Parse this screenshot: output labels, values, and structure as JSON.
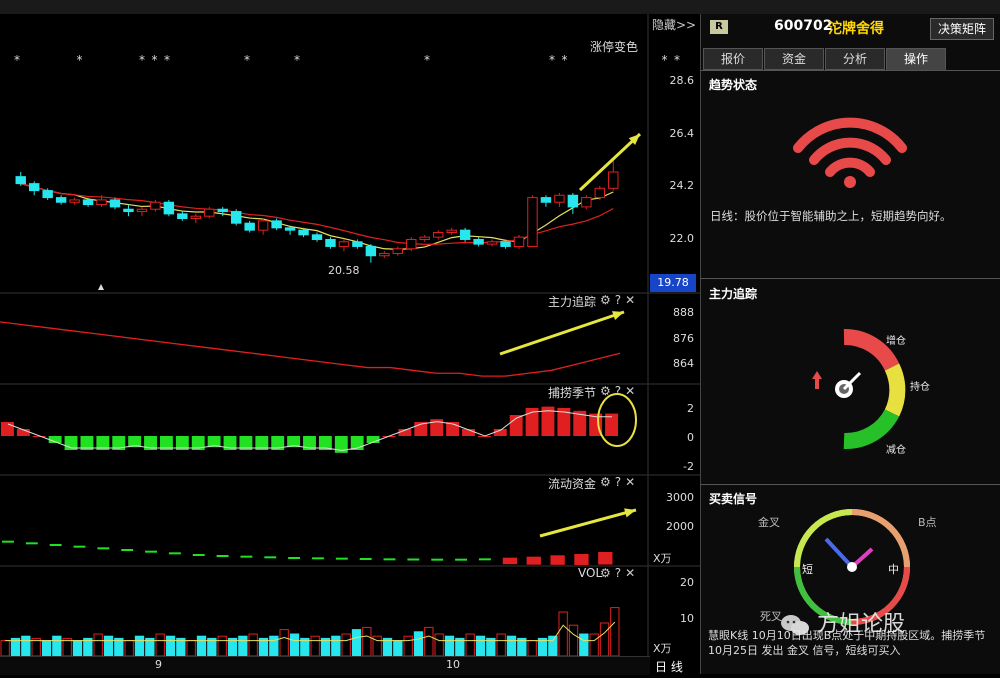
{
  "toolbar": {
    "hide_label": "隐藏>>"
  },
  "main_chart": {
    "title": "涨停变色",
    "price_ticks": [
      "28.6",
      "26.4",
      "24.2",
      "22.0"
    ],
    "current_price": "19.78",
    "low_annotation": "20.58",
    "marker_char": "*"
  },
  "indicators": {
    "main_tracking": {
      "title": "主力追踪",
      "ticks": [
        "888",
        "876",
        "864"
      ]
    },
    "season": {
      "title": "捕捞季节",
      "ticks": [
        "2",
        "0",
        "-2"
      ]
    },
    "flow": {
      "title": "流动资金",
      "ticks": [
        "3000",
        "2000"
      ],
      "unit": "X万"
    },
    "vol": {
      "title": "VOL",
      "ticks": [
        "20",
        "10"
      ],
      "unit": "X万"
    },
    "icons": {
      "settings": "gear-icon",
      "help_label": "?",
      "close_label": "✕"
    }
  },
  "x_axis": {
    "labels": [
      "9",
      "10"
    ],
    "period": "日 线"
  },
  "right_panel": {
    "badge": "R",
    "stock_code": "600702",
    "stock_name": "沱牌舍得",
    "decision_button": "决策矩阵",
    "tabs": [
      "报价",
      "资金",
      "分析",
      "操作"
    ],
    "active_tab": "操作",
    "trend": {
      "title": "趋势状态",
      "description": "日线：股价位于智能辅助之上，短期趋势向好。"
    },
    "tracking": {
      "title": "主力追踪",
      "labels": [
        "增仓",
        "持仓",
        "减仓"
      ]
    },
    "signals": {
      "title": "买卖信号",
      "labels": [
        "金叉",
        "B点",
        "短",
        "中",
        "死叉"
      ]
    },
    "bottom_text": "慧眼K线  10月10日出现B点处于中期持股区域。捕捞季节  10月25日 发出 金叉 信号，短线可买入"
  },
  "watermark": "方姐论股",
  "colors": {
    "up": "#e02020",
    "down": "#28e6ee",
    "green": "#22e022",
    "arrow": "#e6e640",
    "price_box": "#1645c8"
  },
  "chart_data": {
    "type": "candlestick",
    "x_labels": [
      "9",
      "10"
    ],
    "price_axis": {
      "ticks": [
        28.6,
        26.4,
        24.2,
        22.0
      ],
      "ylim": [
        19.6,
        29.4
      ]
    },
    "candles": [
      [
        24.3,
        24.0,
        24.5,
        23.9
      ],
      [
        24.0,
        23.7,
        24.1,
        23.5
      ],
      [
        23.7,
        23.4,
        23.8,
        23.3
      ],
      [
        23.4,
        23.2,
        23.5,
        23.1
      ],
      [
        23.2,
        23.3,
        23.4,
        23.1
      ],
      [
        23.3,
        23.1,
        23.4,
        23.0
      ],
      [
        23.1,
        23.3,
        23.5,
        23.0
      ],
      [
        23.3,
        23.0,
        23.4,
        22.9
      ],
      [
        22.9,
        22.8,
        23.1,
        22.6
      ],
      [
        22.8,
        22.9,
        23.0,
        22.6
      ],
      [
        22.9,
        23.2,
        23.3,
        22.8
      ],
      [
        23.2,
        22.7,
        23.3,
        22.6
      ],
      [
        22.7,
        22.5,
        22.8,
        22.4
      ],
      [
        22.5,
        22.6,
        22.7,
        22.3
      ],
      [
        22.6,
        22.9,
        23.0,
        22.5
      ],
      [
        22.9,
        22.8,
        23.0,
        22.6
      ],
      [
        22.8,
        22.3,
        22.9,
        22.2
      ],
      [
        22.3,
        22.0,
        22.4,
        21.9
      ],
      [
        22.0,
        22.4,
        22.5,
        21.8
      ],
      [
        22.4,
        22.1,
        22.5,
        22.0
      ],
      [
        22.1,
        22.0,
        22.2,
        21.8
      ],
      [
        22.0,
        21.8,
        22.1,
        21.7
      ],
      [
        21.8,
        21.6,
        21.9,
        21.5
      ],
      [
        21.6,
        21.3,
        21.7,
        21.2
      ],
      [
        21.3,
        21.5,
        21.6,
        21.1
      ],
      [
        21.5,
        21.3,
        21.6,
        21.2
      ],
      [
        21.3,
        20.9,
        21.4,
        20.6
      ],
      [
        20.9,
        21.0,
        21.1,
        20.8
      ],
      [
        21.0,
        21.2,
        21.3,
        20.9
      ],
      [
        21.2,
        21.6,
        21.7,
        21.1
      ],
      [
        21.6,
        21.7,
        21.8,
        21.5
      ],
      [
        21.7,
        21.9,
        22.0,
        21.6
      ],
      [
        21.9,
        22.0,
        22.1,
        21.8
      ],
      [
        22.0,
        21.6,
        22.1,
        21.5
      ],
      [
        21.6,
        21.4,
        21.7,
        21.3
      ],
      [
        21.4,
        21.5,
        21.6,
        21.3
      ],
      [
        21.5,
        21.3,
        21.6,
        21.2
      ],
      [
        21.3,
        21.7,
        21.8,
        21.2
      ],
      [
        21.3,
        23.4,
        23.5,
        21.3
      ],
      [
        23.4,
        23.2,
        23.5,
        23.0
      ],
      [
        23.2,
        23.5,
        23.6,
        23.0
      ],
      [
        23.5,
        23.0,
        23.6,
        22.7
      ],
      [
        23.0,
        23.4,
        23.5,
        22.9
      ],
      [
        23.4,
        23.8,
        23.9,
        23.3
      ],
      [
        23.8,
        24.5,
        25.0,
        23.7
      ]
    ],
    "main_tracking": [
      882,
      881,
      880,
      879,
      878,
      877,
      876,
      875,
      874,
      873,
      872,
      871,
      870,
      869,
      868,
      867,
      866,
      866,
      865,
      864,
      864,
      863,
      863,
      864,
      865,
      867,
      869,
      871
    ],
    "season": [
      1,
      0.5,
      0,
      -0.5,
      -1,
      -1,
      -1,
      -1,
      -0.8,
      -1,
      -1,
      -1,
      -1,
      -0.8,
      -1,
      -1,
      -1,
      -1,
      -0.8,
      -1,
      -1,
      -1.2,
      -1,
      -0.5,
      0,
      0.5,
      1,
      1.2,
      1,
      0.5,
      0,
      0.5,
      1.5,
      2,
      2.1,
      2,
      1.8,
      1.6,
      1.6
    ],
    "flow": [
      1600,
      1550,
      1500,
      1450,
      1400,
      1350,
      1300,
      1250,
      1200,
      1170,
      1150,
      1130,
      1110,
      1100,
      1090,
      1080,
      1070,
      1065,
      1060,
      1060,
      1070,
      1090,
      1120,
      1160,
      1200,
      1260
    ],
    "volume": [
      7,
      8,
      9,
      8,
      7,
      9,
      8,
      7,
      8,
      10,
      9,
      8,
      7,
      9,
      8,
      10,
      9,
      8,
      7,
      9,
      8,
      9,
      8,
      9,
      10,
      8,
      9,
      12,
      10,
      8,
      9,
      8,
      9,
      10,
      12,
      13,
      9,
      8,
      7,
      9,
      11,
      13,
      10,
      9,
      8,
      10,
      9,
      8,
      10,
      9,
      8,
      7,
      8,
      9,
      20,
      14,
      10,
      10,
      15,
      22
    ]
  }
}
